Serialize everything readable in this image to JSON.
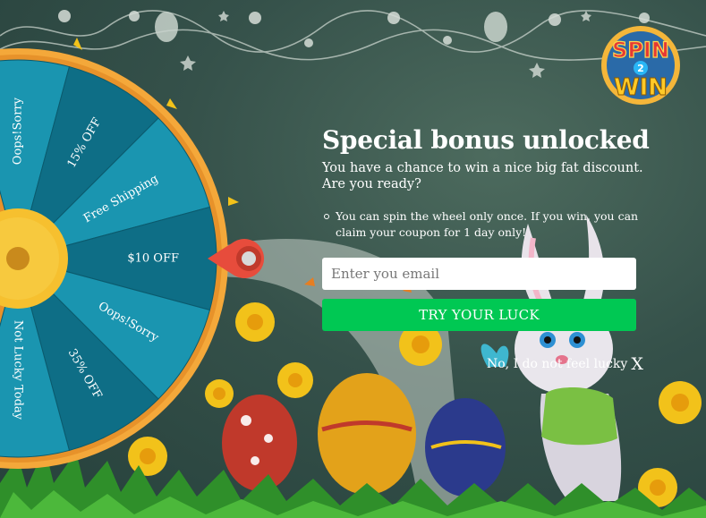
{
  "title": "Special bonus unlocked",
  "subtitle": "You have a chance to win a nice big fat discount. Are you ready?",
  "rules": [
    "You can spin the wheel only once. If you win, you can claim your coupon for 1 day only!"
  ],
  "email_placeholder": "Enter you email",
  "cta_label": "TRY YOUR LUCK",
  "decline_label": "No, I do not feel lucky",
  "decline_close": "X",
  "logo": {
    "top": "SPIN",
    "middle": "2",
    "bottom": "WIN"
  },
  "wheel": {
    "segments": [
      "Oops!Sorry",
      "15% OFF",
      "Free Shipping",
      "$10 OFF",
      "Oops!Sorry",
      "35% OFF",
      "Not Lucky Today"
    ]
  },
  "colors": {
    "cta": "#00c853",
    "wheel_dark": "#0e6e86",
    "wheel_light": "#1a95b0",
    "wheel_rim": "#f4a83a",
    "pointer": "#e74c3c"
  },
  "icons": [
    "pointer-icon",
    "close-icon",
    "spin-win-logo"
  ]
}
